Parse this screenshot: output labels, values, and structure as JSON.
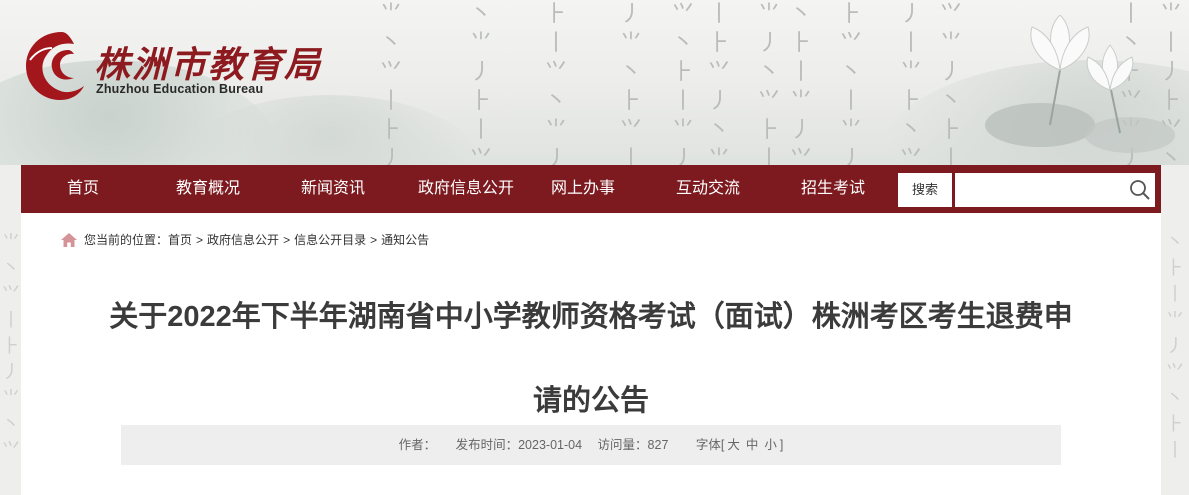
{
  "header": {
    "logo_cn": "株洲市教育局",
    "logo_en": "Zhuzhou Education Bureau",
    "brand_color": "#8c1a1f"
  },
  "nav": {
    "items": [
      "首页",
      "教育概况",
      "新闻资讯",
      "政府信息公开",
      "网上办事",
      "互动交流",
      "招生考试"
    ],
    "search_label": "搜索",
    "search_value": "",
    "bg_color": "#7c1a1f"
  },
  "breadcrumb": {
    "prefix": "您当前的位置：",
    "items": [
      "首页",
      "政府信息公开",
      "信息公开目录",
      "通知公告"
    ]
  },
  "article": {
    "title_line1": "关于2022年下半年湖南省中小学教师资格考试（面试）株洲考区考生退费申",
    "title_line2": "请的公告",
    "author_label": "作者：",
    "publish_label": "发布时间：",
    "publish_date": "2023-01-04",
    "views_label": "访问量：",
    "views": "827",
    "font_label": "字体[",
    "font_large": "大",
    "font_medium": "中",
    "font_small": "小",
    "font_close": "]"
  }
}
